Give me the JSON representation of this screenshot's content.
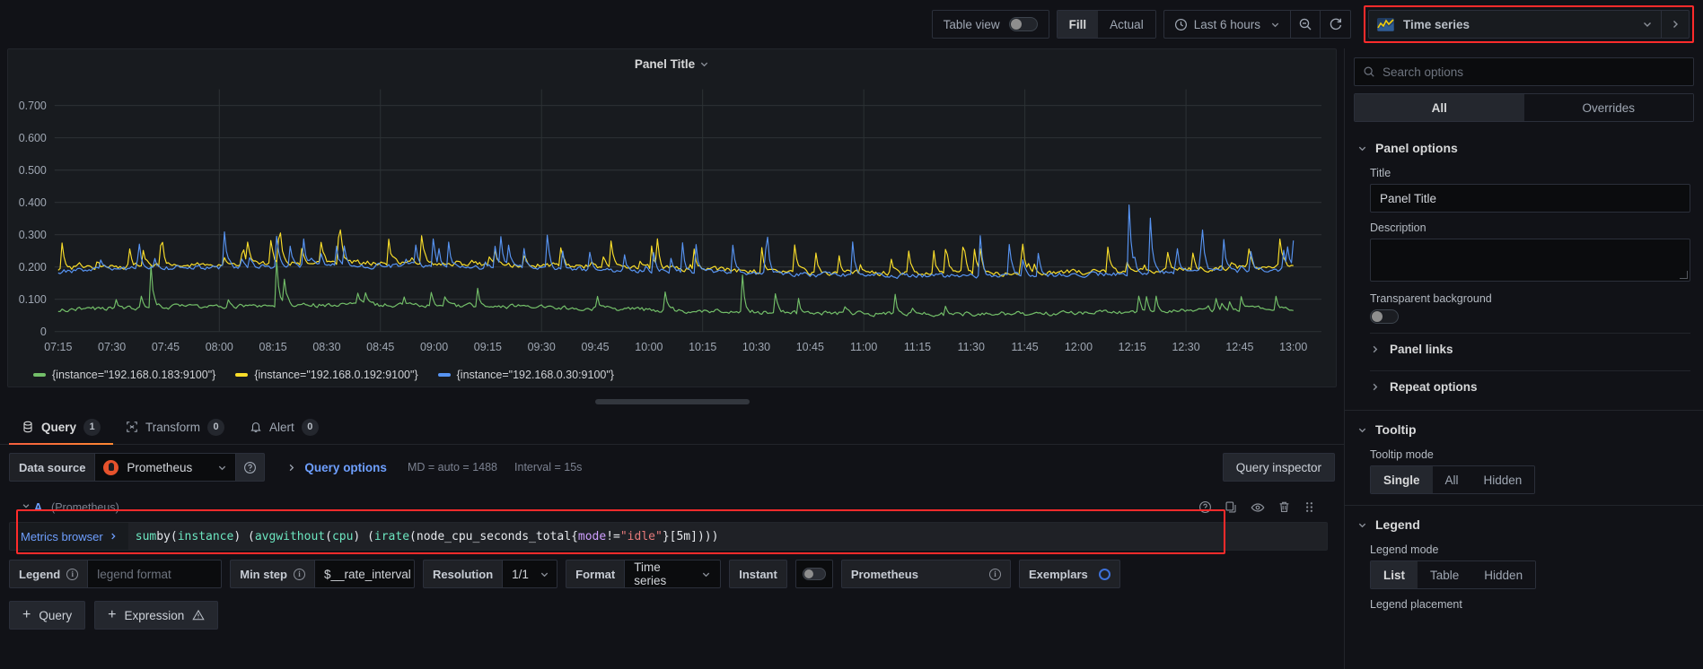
{
  "toolbar": {
    "table_view_label": "Table view",
    "table_view_on": false,
    "fill_label": "Fill",
    "actual_label": "Actual",
    "scale_active": "Fill",
    "time_range": "Last 6 hours",
    "zoom_out_icon": "zoom-out-icon",
    "refresh_icon": "refresh-icon",
    "viz_picker_label": "Time series",
    "viz_picker_icon": "time-series-icon"
  },
  "panel": {
    "title": "Panel Title",
    "title_caret": "chevron-down-icon"
  },
  "chart_data": {
    "type": "line",
    "title": "Panel Title",
    "xlabel": "",
    "ylabel": "",
    "grid": true,
    "legend_position": "bottom",
    "ylim": [
      0,
      0.75
    ],
    "ytick_labels": [
      "0.700",
      "0.600",
      "0.500",
      "0.400",
      "0.300",
      "0.200",
      "0.100",
      "0"
    ],
    "ytick_values": [
      0.7,
      0.6,
      0.5,
      0.4,
      0.3,
      0.2,
      0.1,
      0
    ],
    "xtick_labels": [
      "07:15",
      "07:30",
      "07:45",
      "08:00",
      "08:15",
      "08:30",
      "08:45",
      "09:00",
      "09:15",
      "09:30",
      "09:45",
      "10:00",
      "10:15",
      "10:30",
      "10:45",
      "11:00",
      "11:15",
      "11:30",
      "11:45",
      "12:00",
      "12:15",
      "12:30",
      "12:45",
      "13:00"
    ],
    "series": [
      {
        "name": "{instance=\"192.168.0.183:9100\"}",
        "color": "#73bf69",
        "baseline": 0.068,
        "noise": 0.022,
        "spike_rate": 0.06,
        "spike_height": 0.055,
        "seed": 11
      },
      {
        "name": "{instance=\"192.168.0.192:9100\"}",
        "color": "#fade2a",
        "baseline": 0.197,
        "noise": 0.026,
        "spike_rate": 0.1,
        "spike_height": 0.085,
        "seed": 23
      },
      {
        "name": "{instance=\"192.168.0.30:9100\"}",
        "color": "#5794f2",
        "baseline": 0.188,
        "noise": 0.024,
        "spike_rate": 0.09,
        "spike_height": 0.105,
        "seed": 37
      }
    ]
  },
  "tabs": [
    {
      "label": "Query",
      "count": "1",
      "icon": "database-icon",
      "active": true
    },
    {
      "label": "Transform",
      "count": "0",
      "icon": "transform-icon",
      "active": false
    },
    {
      "label": "Alert",
      "count": "0",
      "icon": "bell-icon",
      "active": false
    }
  ],
  "query_editor": {
    "data_source_label": "Data source",
    "data_source_value": "Prometheus",
    "help_icon": "help-circle-icon",
    "query_options_label": "Query options",
    "query_options_meta_md": "MD = auto = 1488",
    "query_options_meta_interval": "Interval = 15s",
    "query_inspector_label": "Query inspector",
    "row": {
      "id": "A",
      "datasource": "(Prometheus)",
      "metrics_browser_label": "Metrics browser",
      "expression": "sum by(instance) (avg without(cpu) (irate(node_cpu_seconds_total{mode!=\"idle\"}[5m])))",
      "expression_tokens": [
        {
          "t": "sum",
          "c": "fn"
        },
        {
          "t": " by",
          "c": "plain"
        },
        {
          "t": "(",
          "c": "plain"
        },
        {
          "t": "instance",
          "c": "fn"
        },
        {
          "t": ") (",
          "c": "plain"
        },
        {
          "t": "avg",
          "c": "fn"
        },
        {
          "t": " without",
          "c": "fn"
        },
        {
          "t": "(",
          "c": "plain"
        },
        {
          "t": "cpu",
          "c": "fn"
        },
        {
          "t": ") (",
          "c": "plain"
        },
        {
          "t": "irate",
          "c": "fn"
        },
        {
          "t": "(node_cpu_seconds_total",
          "c": "plain"
        },
        {
          "t": "{",
          "c": "plain"
        },
        {
          "t": "mode",
          "c": "lbl"
        },
        {
          "t": "!=",
          "c": "plain"
        },
        {
          "t": "\"idle\"",
          "c": "str"
        },
        {
          "t": "}[5m])))",
          "c": "plain"
        }
      ],
      "actions": [
        "help-circle-icon",
        "duplicate-icon",
        "eye-icon",
        "trash-icon",
        "drag-handle-icon"
      ]
    },
    "options": {
      "legend_label": "Legend",
      "legend_placeholder": "legend format",
      "legend_value": "",
      "min_step_label": "Min step",
      "min_step_value": "$__rate_interval",
      "resolution_label": "Resolution",
      "resolution_value": "1/1",
      "format_label": "Format",
      "format_value": "Time series",
      "instant_label": "Instant",
      "instant_on": false,
      "prometheus_label": "Prometheus",
      "exemplars_label": "Exemplars",
      "exemplars_icon": "exemplar-target-icon"
    },
    "add_query_label": "Query",
    "add_expression_label": "Expression"
  },
  "options_pane": {
    "search_placeholder": "Search options",
    "search_icon": "search-icon",
    "tabs": [
      {
        "label": "All",
        "active": true
      },
      {
        "label": "Overrides",
        "active": false
      }
    ],
    "sections": [
      {
        "title": "Panel options",
        "fields": {
          "title_label": "Title",
          "title_value": "Panel Title",
          "description_label": "Description",
          "description_value": "",
          "transparent_label": "Transparent background",
          "transparent_on": false,
          "panel_links_label": "Panel links",
          "repeat_options_label": "Repeat options"
        }
      },
      {
        "title": "Tooltip",
        "fields": {
          "tooltip_mode_label": "Tooltip mode",
          "tooltip_modes": [
            "Single",
            "All",
            "Hidden"
          ],
          "tooltip_mode_active": "Single"
        }
      },
      {
        "title": "Legend",
        "fields": {
          "legend_mode_label": "Legend mode",
          "legend_modes": [
            "List",
            "Table",
            "Hidden"
          ],
          "legend_mode_active": "List",
          "legend_placement_label": "Legend placement"
        }
      }
    ]
  },
  "colors": {
    "accent_blue": "#6e9fff",
    "accent_orange": "#f55f3e",
    "highlight_red": "#ff2b2b",
    "series_green": "#73bf69",
    "series_yellow": "#fade2a",
    "series_blue": "#5794f2"
  }
}
